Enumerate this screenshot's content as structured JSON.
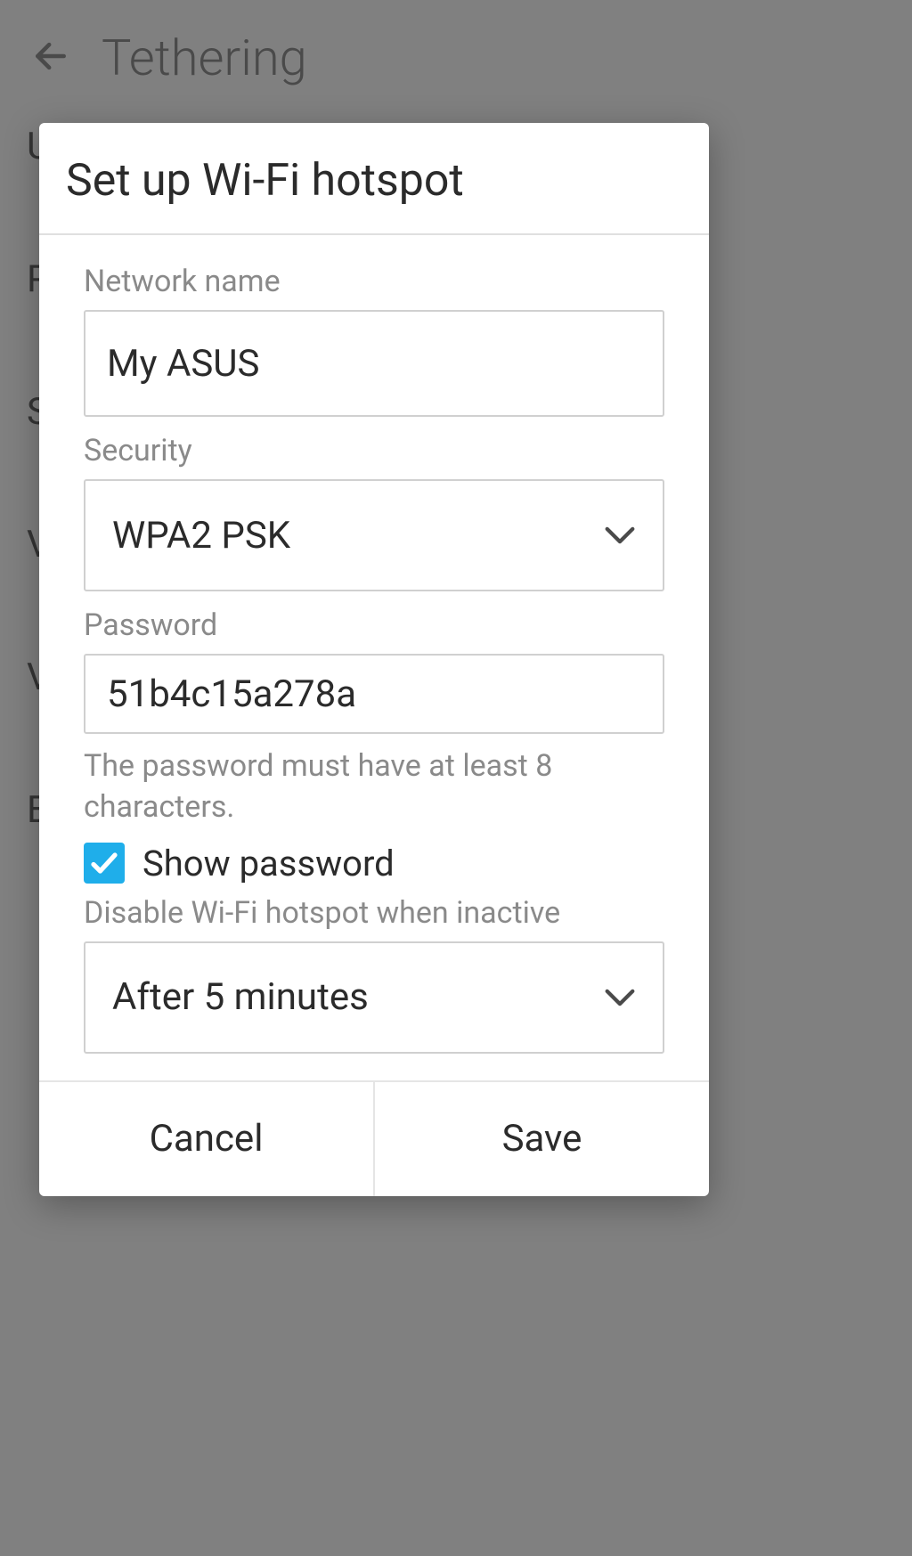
{
  "header": {
    "title": "Tethering"
  },
  "dialog": {
    "title": "Set up Wi-Fi hotspot",
    "network_name_label": "Network name",
    "network_name_value": "My ASUS",
    "security_label": "Security",
    "security_value": "WPA2 PSK",
    "password_label": "Password",
    "password_value": "51b4c15a278a",
    "password_helper": "The password must have at least 8 characters.",
    "show_password_label": "Show password",
    "show_password_checked": true,
    "disable_label": "Disable Wi-Fi hotspot when inactive",
    "disable_value": "After 5 minutes",
    "cancel_label": "Cancel",
    "save_label": "Save"
  },
  "background_items": [
    "U",
    "P",
    "S",
    "V",
    "V",
    "E"
  ]
}
